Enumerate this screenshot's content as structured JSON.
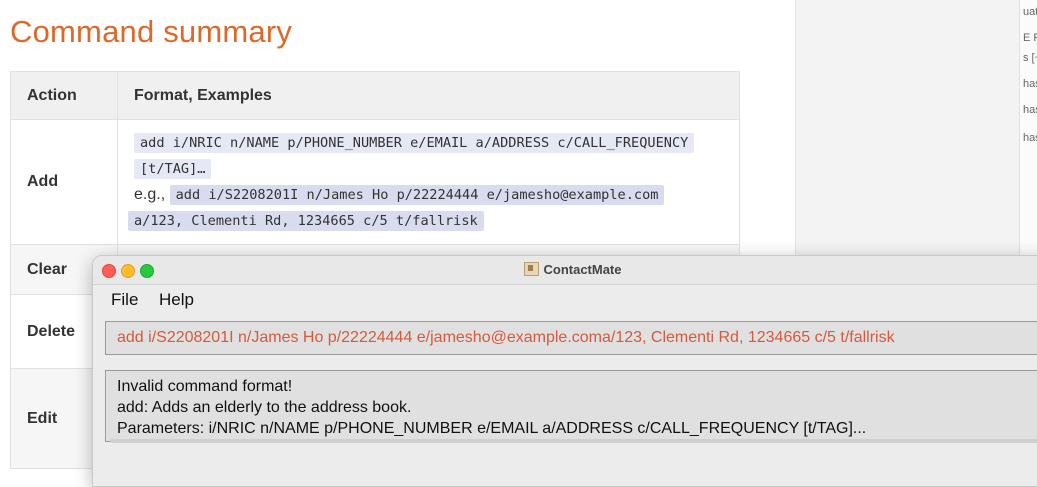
{
  "doc": {
    "title": "Command summary",
    "table": {
      "headers": [
        "Action",
        "Format, Examples"
      ],
      "rows": {
        "add": {
          "action": "Add",
          "format_line1": "add i/NRIC n/NAME p/PHONE_NUMBER e/EMAIL a/ADDRESS c/CALL_FREQUENCY",
          "format_line2": "[t/TAG]…",
          "eg_label": "e.g.,",
          "example_line1": "add i/S2208201I n/James Ho p/22224444 e/jamesho@example.com",
          "example_line2": "a/123, Clementi Rd, 1234665 c/5 t/fallrisk"
        },
        "clear": {
          "action": "Clear"
        },
        "delete": {
          "action": "Delete"
        },
        "edit": {
          "action": "Edit"
        }
      }
    }
  },
  "right_fragments": [
    "uat",
    "E PI",
    "s [~",
    "has",
    "has",
    "has"
  ],
  "app": {
    "window_title": "ContactMate",
    "menu": [
      "File",
      "Help"
    ],
    "command_input": "add i/S2208201I n/James Ho p/22224444 e/jamesho@example.coma/123, Clementi Rd, 1234665 c/5 t/fallrisk",
    "result_lines": [
      "Invalid command format!",
      "add: Adds an elderly to the address book.",
      "Parameters: i/NRIC n/NAME p/PHONE_NUMBER e/EMAIL a/ADDRESS c/CALL_FREQUENCY [t/TAG]..."
    ]
  },
  "colors": {
    "title_orange": "#e0672a",
    "command_text": "#d65a3c",
    "code_bg": "#e7e8f6"
  }
}
